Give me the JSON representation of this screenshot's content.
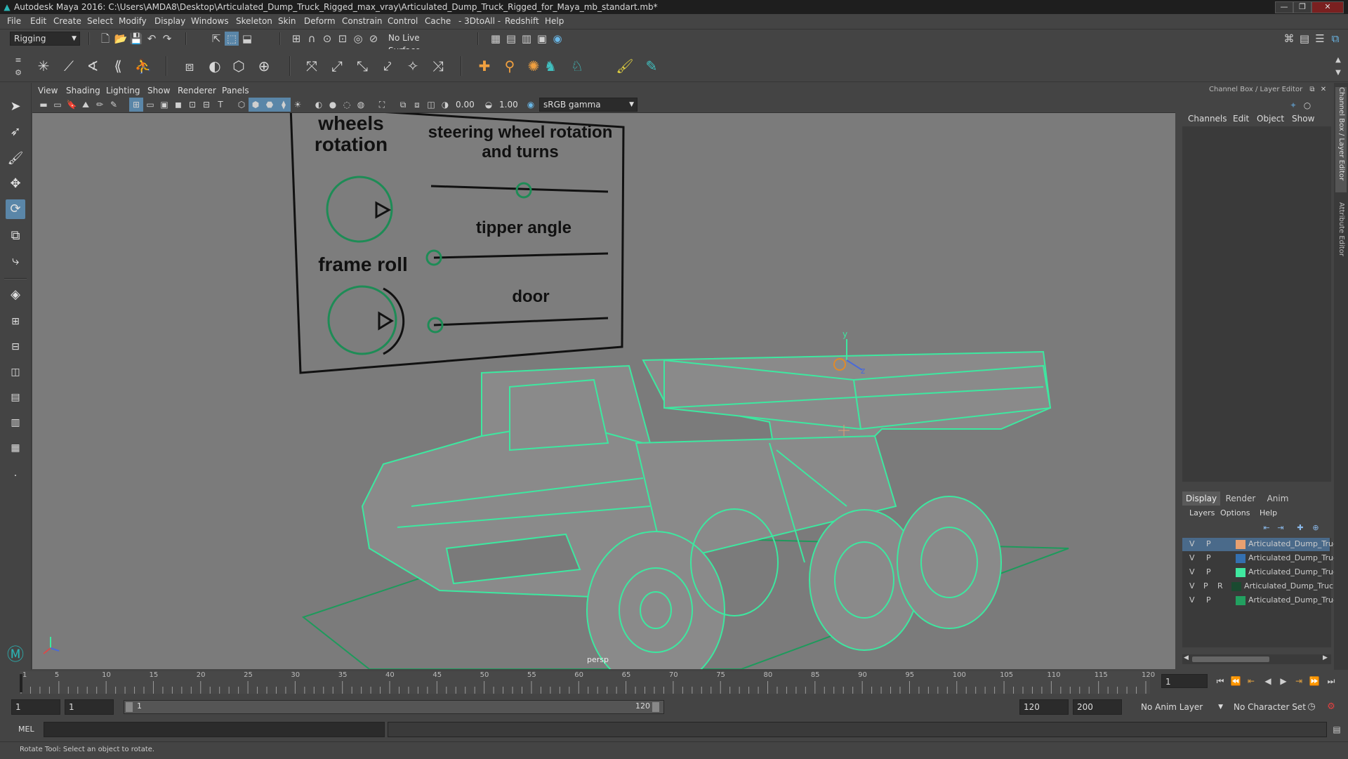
{
  "window": {
    "title": "Autodesk Maya 2016: C:\\Users\\AMDA8\\Desktop\\Articulated_Dump_Truck_Rigged_max_vray\\Articulated_Dump_Truck_Rigged_for_Maya_mb_standart.mb*",
    "minimize": "—",
    "maximize": "❐",
    "close": "✕"
  },
  "menubar": [
    "File",
    "Edit",
    "Create",
    "Select",
    "Modify",
    "Display",
    "Windows",
    "Skeleton",
    "Skin",
    "Deform",
    "Constrain",
    "Control",
    "Cache",
    "- 3DtoAll -",
    "Redshift",
    "Help"
  ],
  "statusline": {
    "mode": "Rigging",
    "live_surface": "No Live Surface"
  },
  "panel": {
    "menu": [
      "View",
      "Shading",
      "Lighting",
      "Show",
      "Renderer",
      "Panels"
    ],
    "exposure": "0.00",
    "gamma": "1.00",
    "color_space": "sRGB gamma",
    "camera_label": "persp"
  },
  "rig_panel": {
    "wheels_rotation": "wheels rotation",
    "steering": "steering wheel rotation and turns",
    "tipper_angle": "tipper angle",
    "frame_roll": "frame roll",
    "door": "door"
  },
  "axis": {
    "y": "y",
    "z": "z"
  },
  "channel_box": {
    "header": "Channel Box / Layer Editor",
    "menu": [
      "Channels",
      "Edit",
      "Object",
      "Show"
    ]
  },
  "layer_editor": {
    "tabs": [
      "Display",
      "Render",
      "Anim"
    ],
    "menu": [
      "Layers",
      "Options",
      "Help"
    ],
    "layers": [
      {
        "v": "V",
        "p": "P",
        "r": "",
        "color": "#e8a070",
        "name": "Articulated_Dump_Truc",
        "selected": true
      },
      {
        "v": "V",
        "p": "P",
        "r": "",
        "color": "#3470b0",
        "name": "Articulated_Dump_Truc",
        "selected": false
      },
      {
        "v": "V",
        "p": "P",
        "r": "",
        "color": "#40e8a0",
        "name": "Articulated_Dump_Truc",
        "selected": false
      },
      {
        "v": "V",
        "p": "P",
        "r": "R",
        "color": "#1a4a30",
        "name": "Articulated_Dump_Truck",
        "selected": false
      },
      {
        "v": "V",
        "p": "P",
        "r": "",
        "color": "#22a060",
        "name": "Articulated_Dump_Truc",
        "selected": false
      }
    ]
  },
  "side_tabs": [
    "Channel Box / Layer Editor",
    "Attribute Editor"
  ],
  "timeline": {
    "ticks": [
      "1",
      "5",
      "10",
      "15",
      "20",
      "25",
      "30",
      "35",
      "40",
      "45",
      "50",
      "55",
      "60",
      "65",
      "70",
      "75",
      "80",
      "85",
      "90",
      "95",
      "100",
      "105",
      "110",
      "115",
      "120"
    ],
    "current_frame": "1"
  },
  "range": {
    "start": "1",
    "playback_start": "1",
    "slider_start": "1",
    "slider_end": "120",
    "playback_end": "120",
    "end": "200",
    "anim_layer": "No Anim Layer",
    "character_set": "No Character Set"
  },
  "command": {
    "language": "MEL"
  },
  "help": {
    "text": "Rotate Tool: Select an object to rotate."
  },
  "colors": {
    "wireframe": "#3de8a0",
    "viewport_bg": "#7b7b7b",
    "panel_bg": "#444444"
  }
}
